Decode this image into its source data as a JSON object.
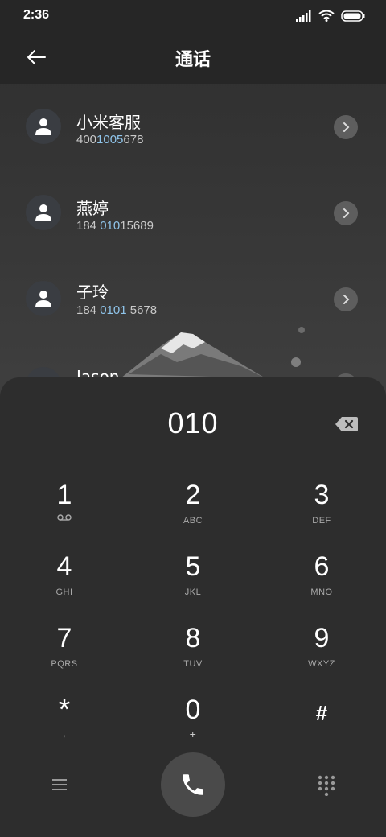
{
  "status_bar": {
    "time": "2:36"
  },
  "header": {
    "title": "通话"
  },
  "contacts": [
    {
      "name": "小米客服",
      "num_pre": "400",
      "num_hl": "1005",
      "num_post": "678"
    },
    {
      "name": "燕婷",
      "num_pre": "184 ",
      "num_hl": "010",
      "num_post": "15689"
    },
    {
      "name": "子玲",
      "num_pre": "184 ",
      "num_hl": "0101",
      "num_post": " 5678"
    },
    {
      "name": "Jason"
    }
  ],
  "dialpad": {
    "display": "010",
    "keys": [
      {
        "digit": "1",
        "letters": ""
      },
      {
        "digit": "2",
        "letters": "ABC"
      },
      {
        "digit": "3",
        "letters": "DEF"
      },
      {
        "digit": "4",
        "letters": "GHI"
      },
      {
        "digit": "5",
        "letters": "JKL"
      },
      {
        "digit": "6",
        "letters": "MNO"
      },
      {
        "digit": "7",
        "letters": "PQRS"
      },
      {
        "digit": "8",
        "letters": "TUV"
      },
      {
        "digit": "9",
        "letters": "WXYZ"
      },
      {
        "digit": "*",
        "letters": ","
      },
      {
        "digit": "0",
        "letters": "+"
      },
      {
        "digit": "#",
        "letters": ""
      }
    ]
  },
  "colors": {
    "highlight": "#8fc4ea",
    "panel": "#2d2d2d",
    "call_button": "#4a4a4a"
  },
  "icons": [
    "back-arrow-icon",
    "person-icon",
    "chevron-right-icon",
    "backspace-icon",
    "voicemail-icon",
    "menu-icon",
    "phone-icon",
    "dialpad-icon",
    "signal-icon",
    "wifi-icon",
    "battery-icon"
  ]
}
